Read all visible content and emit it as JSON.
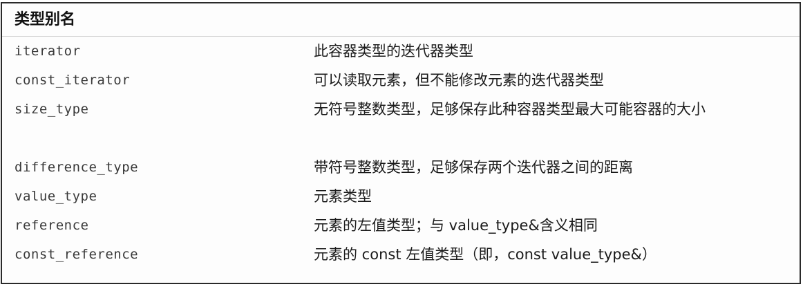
{
  "table": {
    "header": "类型别名",
    "rows": [
      {
        "name": "iterator",
        "desc": "此容器类型的迭代器类型"
      },
      {
        "name": "const_iterator",
        "desc": "可以读取元素，但不能修改元素的迭代器类型"
      },
      {
        "name": "size_type",
        "desc": "无符号整数类型，足够保存此种容器类型最大可能容器的大小"
      },
      {
        "name": "difference_type",
        "desc": "带符号整数类型，足够保存两个迭代器之间的距离"
      },
      {
        "name": "value_type",
        "desc": "元素类型"
      },
      {
        "name": "reference",
        "desc": "元素的左值类型；与 value_type&含义相同"
      },
      {
        "name": "const_reference",
        "desc": "元素的 const 左值类型（即，const value_type&）"
      }
    ]
  }
}
